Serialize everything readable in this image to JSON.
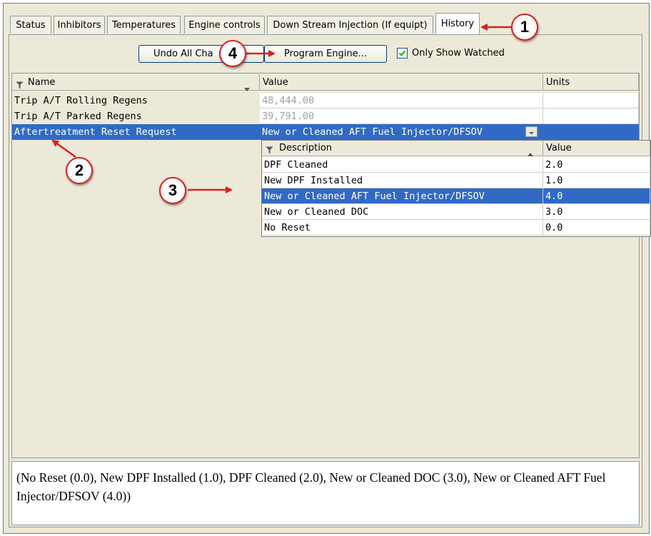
{
  "tabs": [
    {
      "label": "Status",
      "active": false
    },
    {
      "label": "Inhibitors",
      "active": false
    },
    {
      "label": "Temperatures",
      "active": false
    },
    {
      "label": "Engine controls",
      "active": false
    },
    {
      "label": "Down Stream Injection (If equipt)",
      "active": false
    },
    {
      "label": "History",
      "active": true
    }
  ],
  "toolbar": {
    "undo_label": "Undo All Cha",
    "program_label": "Program Engine...",
    "only_watched_label": "Only Show Watched",
    "only_watched_checked": true
  },
  "grid": {
    "columns": {
      "name": "Name",
      "value": "Value",
      "units": "Units"
    },
    "rows": [
      {
        "name": "Trip A/T Rolling Regens",
        "value": "48,444.00",
        "units": ""
      },
      {
        "name": "Trip A/T Parked Regens",
        "value": "39,791.00",
        "units": ""
      },
      {
        "name": "Aftertreatment Reset Request",
        "value": "New or Cleaned AFT Fuel Injector/DFSOV",
        "units": "",
        "selected": true
      }
    ]
  },
  "dropdown": {
    "columns": {
      "description": "Description",
      "value": "Value"
    },
    "options": [
      {
        "description": "DPF Cleaned",
        "value": "2.0"
      },
      {
        "description": "New DPF Installed",
        "value": "1.0"
      },
      {
        "description": "New or Cleaned AFT Fuel Injector/DFSOV",
        "value": "4.0",
        "selected": true
      },
      {
        "description": "New or Cleaned DOC",
        "value": "3.0"
      },
      {
        "description": "No Reset",
        "value": "0.0"
      }
    ]
  },
  "description_text": "(No Reset (0.0), New DPF Installed (1.0), DPF Cleaned (2.0), New or Cleaned DOC (3.0), New or Cleaned AFT Fuel Injector/DFSOV (4.0))",
  "callouts": [
    "1",
    "2",
    "3",
    "4"
  ],
  "colors": {
    "selection": "#316ac5",
    "callout_red": "#d9211e",
    "panel": "#ece9d8",
    "dimmed_value": "#a0a0a0"
  }
}
